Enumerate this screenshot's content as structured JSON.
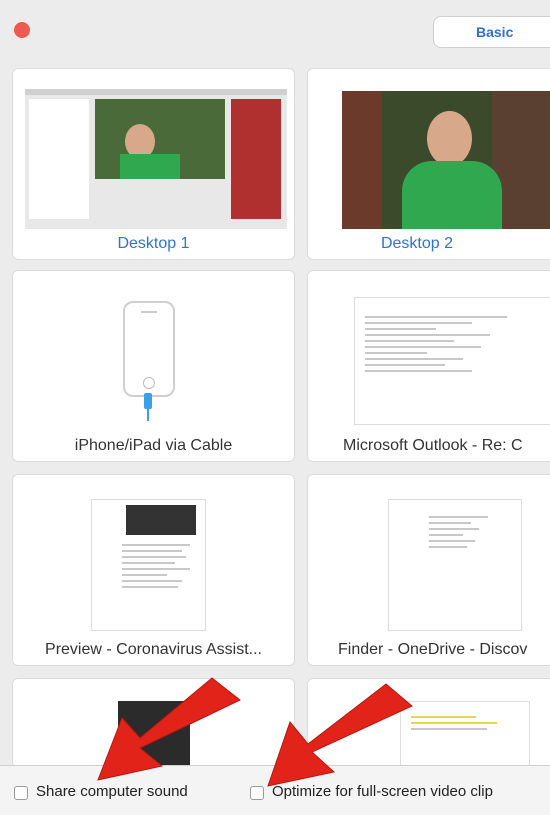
{
  "header": {
    "close_icon": "close-dot-icon",
    "tab_basic": "Basic"
  },
  "tiles": [
    {
      "label": "Desktop 1",
      "selected": false,
      "label_color": "#2f74d0"
    },
    {
      "label": "Desktop 2",
      "selected": false,
      "label_color": "#2f74d0"
    },
    {
      "label": "iPhone/iPad via Cable"
    },
    {
      "label": "Microsoft Outlook - Re: C"
    },
    {
      "label": "Preview - Coronavirus Assist..."
    },
    {
      "label": "Finder - OneDrive - Discov"
    }
  ],
  "options": {
    "share_sound": "Share computer sound",
    "optimize_video": "Optimize for full-screen video clip"
  },
  "colors": {
    "accent": "#2f74d0",
    "arrow": "#e2231a",
    "close": "#ef5a50"
  }
}
